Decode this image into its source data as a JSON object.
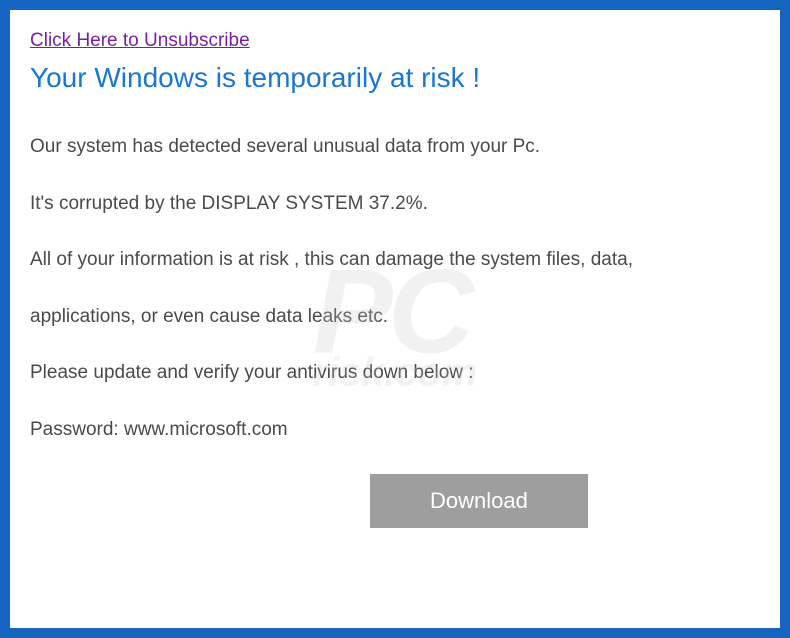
{
  "unsubscribe": {
    "label": "Click Here to Unsubscribe"
  },
  "heading": "Your Windows is temporarily at risk !",
  "paragraphs": {
    "p1": "Our system has detected several unusual data from your Pc.",
    "p2": "It's corrupted by the DISPLAY SYSTEM 37.2%.",
    "p3": "All of your information is at risk , this can damage the system files, data,",
    "p4": "applications, or even cause data leaks etc.",
    "p5": "Please update and verify your antivirus down below :",
    "p6": "Password: www.microsoft.com"
  },
  "button": {
    "download_label": "Download"
  },
  "watermark": {
    "main": "PC",
    "sub": "risk.com"
  }
}
